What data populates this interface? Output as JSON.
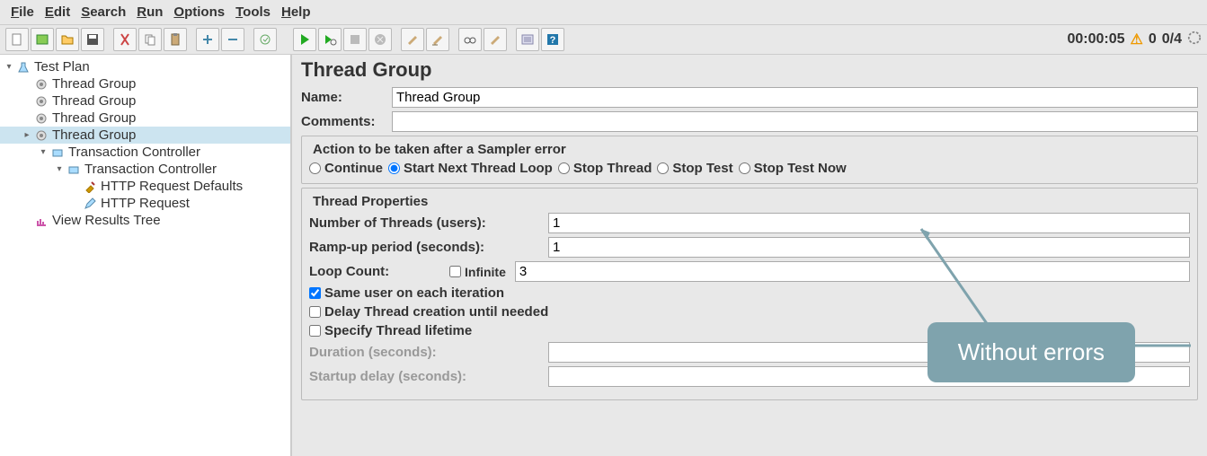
{
  "menu": {
    "items": [
      "File",
      "Edit",
      "Search",
      "Run",
      "Options",
      "Tools",
      "Help"
    ]
  },
  "status": {
    "time": "00:00:05",
    "warn": "0",
    "threads": "0/4"
  },
  "tree": {
    "root": "Test Plan",
    "items": [
      {
        "label": "Thread Group",
        "indent": 1,
        "icon": "gear"
      },
      {
        "label": "Thread Group",
        "indent": 1,
        "icon": "gear"
      },
      {
        "label": "Thread Group",
        "indent": 1,
        "icon": "gear"
      },
      {
        "label": "Thread Group",
        "indent": 1,
        "icon": "gear",
        "selected": true,
        "toggle": "▸"
      },
      {
        "label": "Transaction Controller",
        "indent": 2,
        "icon": "tc",
        "toggle": "▾"
      },
      {
        "label": "Transaction Controller",
        "indent": 3,
        "icon": "tc",
        "toggle": "▾"
      },
      {
        "label": "HTTP Request Defaults",
        "indent": 4,
        "icon": "wrench"
      },
      {
        "label": "HTTP Request",
        "indent": 4,
        "icon": "pencil"
      },
      {
        "label": "View Results Tree",
        "indent": 1,
        "icon": "chart"
      }
    ]
  },
  "panel": {
    "title": "Thread Group",
    "name_label": "Name:",
    "name_value": "Thread Group",
    "comments_label": "Comments:",
    "comments_value": "",
    "action_group": "Action to be taken after a Sampler error",
    "actions": {
      "continue": "Continue",
      "start_next": "Start Next Thread Loop",
      "stop_thread": "Stop Thread",
      "stop_test": "Stop Test",
      "stop_test_now": "Stop Test Now"
    },
    "props_title": "Thread Properties",
    "num_threads_label": "Number of Threads (users):",
    "num_threads_value": "1",
    "ramp_label": "Ramp-up period (seconds):",
    "ramp_value": "1",
    "loop_label": "Loop Count:",
    "infinite_label": "Infinite",
    "loop_value": "3",
    "same_user": "Same user on each iteration",
    "delay_creation": "Delay Thread creation until needed",
    "specify_lifetime": "Specify Thread lifetime",
    "duration_label": "Duration (seconds):",
    "startup_label": "Startup delay (seconds):"
  },
  "annotation": {
    "text": "Without errors"
  }
}
